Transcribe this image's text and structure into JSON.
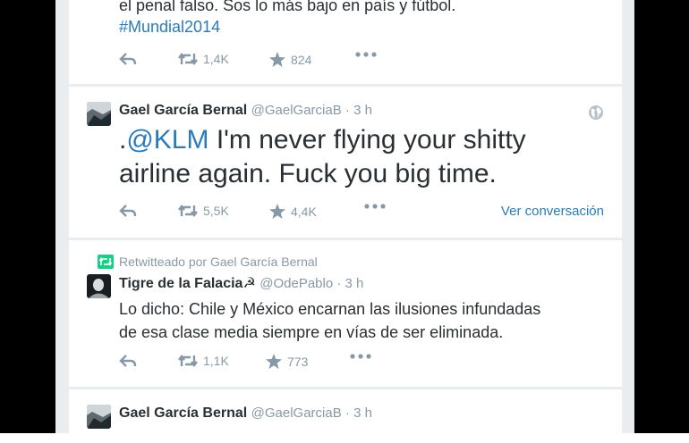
{
  "tweets": [
    {
      "text_line1": "el penal falso. Sos lo más bajo en país y fútbol.",
      "hashtag": "#Mundial2014",
      "retweets": "1,4K",
      "favorites": "824"
    },
    {
      "name": "Gael García Bernal",
      "handle": "@GaelGarciaB · 3 h",
      "text_prefix": ".",
      "mention": "@KLM",
      "text_line1_rest": " I'm never flying your shitty",
      "text_line2": "airline again. Fuck you big time.",
      "retweets": "5,5K",
      "favorites": "4,4K",
      "view_conversation": "Ver conversación"
    },
    {
      "retweet_context": "Retwitteado por Gael García Bernal",
      "name": "Tigre de la Falacia☭",
      "handle": "@OdePablo · 3 h",
      "text_line1": "Lo dicho: Chile y México encarnan las ilusiones infundadas",
      "text_line2": "de esa clase media siempre en vías de ser eliminada.",
      "retweets": "1,1K",
      "favorites": "773"
    },
    {
      "name": "Gael García Bernal",
      "handle": "@GaelGarciaB · 3 h"
    }
  ],
  "colors": {
    "link": "#2b7bb9",
    "text": "#292f33",
    "muted": "#8899a6",
    "retweet_green": "#19cf86"
  },
  "icons": [
    "reply-icon",
    "retweet-icon",
    "favorite-icon",
    "more-icon",
    "globe-icon"
  ]
}
